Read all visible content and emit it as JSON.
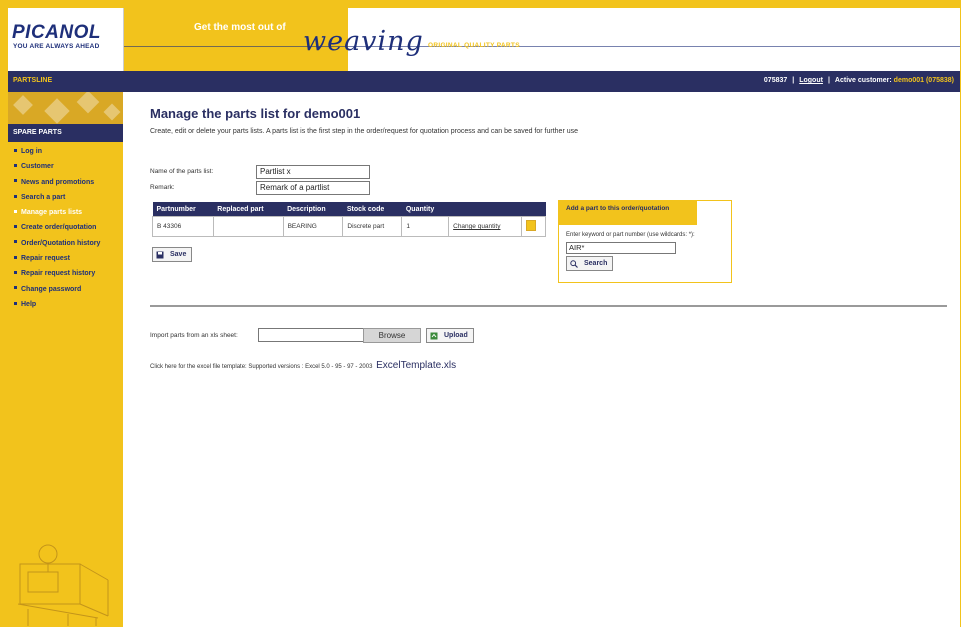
{
  "brand": {
    "logo": "PICANOL",
    "tagline": "YOU ARE ALWAYS AHEAD",
    "promo": "Get the most out of",
    "promo_word": "weaving",
    "quality": "ORIGINAL QUALITY PARTS"
  },
  "nav": {
    "section": "PARTSLINE",
    "user_id": "075837",
    "logout": "Logout",
    "active_label": "Active customer:",
    "active_customer": "demo001 (075838)"
  },
  "sidebar": {
    "heading": "SPARE PARTS",
    "items": [
      {
        "label": "Log in"
      },
      {
        "label": "Customer"
      },
      {
        "label": "News and promotions"
      },
      {
        "label": "Search a part"
      },
      {
        "label": "Manage parts lists",
        "active": true
      },
      {
        "label": "Create order/quotation"
      },
      {
        "label": "Order/Quotation history"
      },
      {
        "label": "Repair request"
      },
      {
        "label": "Repair request history"
      },
      {
        "label": "Change password"
      },
      {
        "label": "Help"
      }
    ]
  },
  "main": {
    "title": "Manage the parts list for demo001",
    "description": "Create, edit or delete your parts lists. A parts list is the first step in the order/request for quotation process and can be saved for further use",
    "form": {
      "name_label": "Name of the parts list:",
      "name_value": "Partlist x",
      "remark_label": "Remark:",
      "remark_value": "Remark of a partlist"
    },
    "table": {
      "headers": [
        "Partnumber",
        "Replaced part",
        "Description",
        "Stock code",
        "Quantity"
      ],
      "rows": [
        {
          "partnumber": "B 43306",
          "replaced": "",
          "description": "BEARING",
          "stock_code": "Discrete part",
          "quantity": "1",
          "action": "Change quantity"
        }
      ]
    },
    "save_label": "Save",
    "add_part": {
      "heading": "Add a part to this order/quotation",
      "label": "Enter keyword or part number (use wildcards: *):",
      "value": "AIR*",
      "search_label": "Search"
    },
    "import": {
      "label": "Import parts from an xls sheet:",
      "browse_label": "Browse",
      "upload_label": "Upload"
    },
    "template": {
      "text": "Click here for the excel file template: Supported versions : Excel 5.0 - 95 - 97 - 2003",
      "link": "ExcelTemplate.xls"
    }
  },
  "colors": {
    "accent": "#f2c31c",
    "navy": "#2a2f62",
    "brand_blue": "#1e2f7a"
  }
}
